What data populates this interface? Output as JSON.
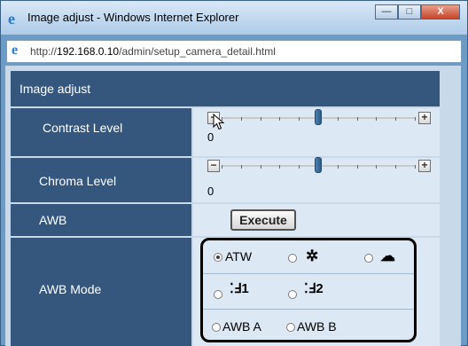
{
  "window": {
    "title": "Image adjust - Windows Internet Explorer",
    "buttons": {
      "minimize": "—",
      "maximize": "□",
      "close": "X"
    }
  },
  "address": {
    "prefix": "http://",
    "host": "192.168.0.10",
    "path": "/admin/setup_camera_detail.html"
  },
  "page": {
    "title": "Image adjust",
    "rows": {
      "contrast": {
        "label": "Contrast Level",
        "value": "0",
        "slider_fraction": 0.5
      },
      "chroma": {
        "label": "Chroma Level",
        "value": "0",
        "slider_fraction": 0.5
      },
      "awb": {
        "label": "AWB",
        "button": "Execute"
      },
      "awb_mode": {
        "label": "AWB Mode",
        "options": {
          "atw": {
            "label": "ATW",
            "checked": true
          },
          "sun": {
            "icon": "sun-icon",
            "checked": false
          },
          "cloud": {
            "icon": "cloud-icon",
            "checked": false
          },
          "fluor1": {
            "icon": "fluorescent-1-icon",
            "checked": false
          },
          "fluor2": {
            "icon": "fluorescent-2-icon",
            "checked": false
          },
          "awba": {
            "label": "AWB A",
            "checked": false
          },
          "awbb": {
            "label": "AWB B",
            "checked": false
          }
        }
      }
    }
  },
  "colors": {
    "header": "#35577d",
    "control_bg": "#dce8f4",
    "frame": "#6c9bc6"
  }
}
